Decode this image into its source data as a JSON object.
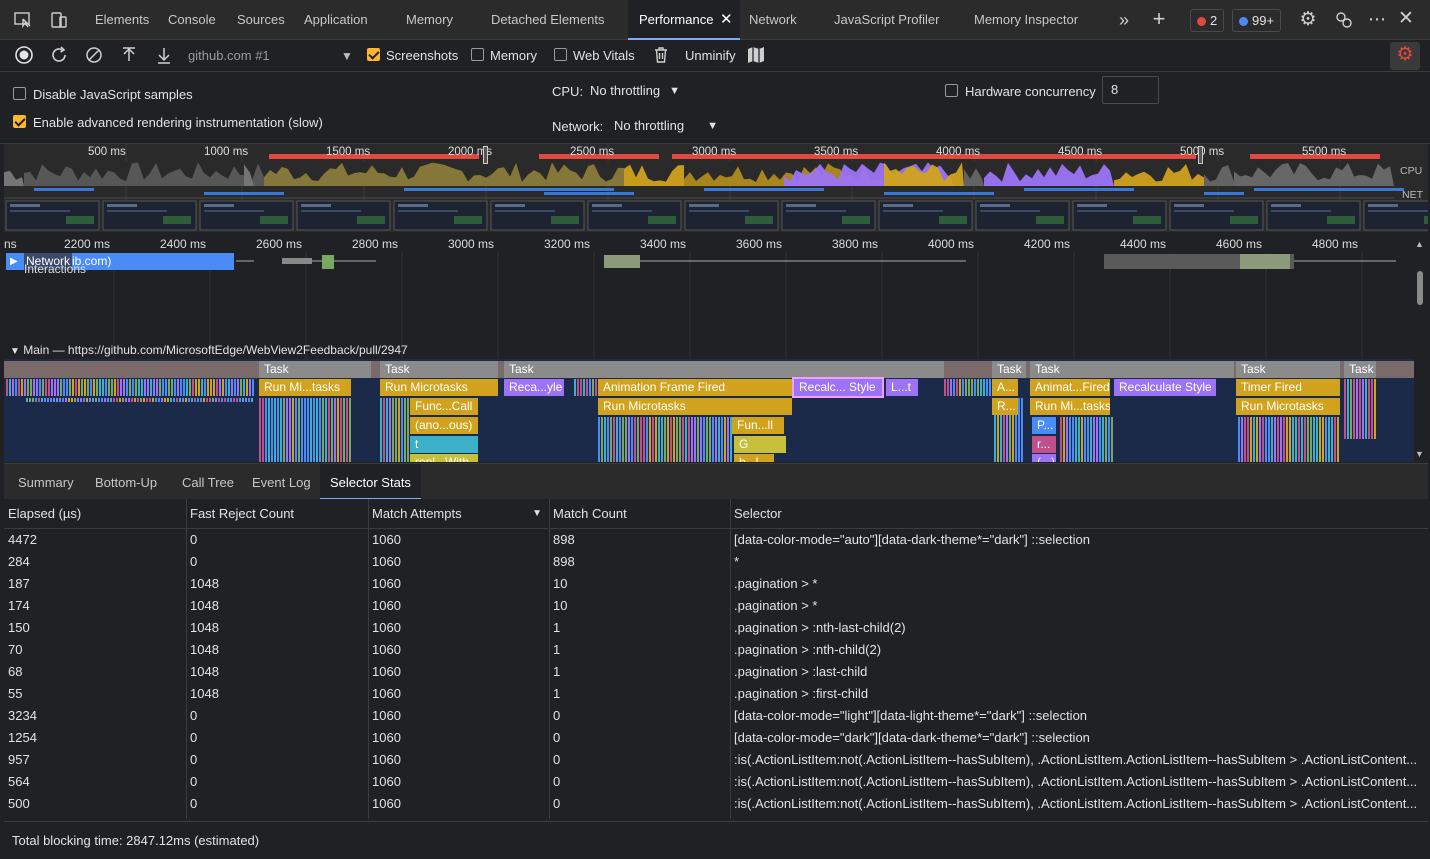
{
  "tabs": [
    {
      "label": "Elements"
    },
    {
      "label": "Console"
    },
    {
      "label": "Sources"
    },
    {
      "label": "Application"
    },
    {
      "label": "Memory"
    },
    {
      "label": "Detached Elements"
    },
    {
      "label": "Performance"
    },
    {
      "label": "Network"
    },
    {
      "label": "JavaScript Profiler"
    },
    {
      "label": "Memory Inspector"
    }
  ],
  "active_tab": "Performance",
  "badges": {
    "errors": "2",
    "messages": "99+"
  },
  "toolbar": {
    "target": "github.com #1",
    "screenshots_label": "Screenshots",
    "memory_label": "Memory",
    "web_vitals_label": "Web Vitals",
    "unminify_label": "Unminify"
  },
  "settings": {
    "disable_js_samples": "Disable JavaScript samples",
    "advanced_rendering": "Enable advanced rendering instrumentation (slow)",
    "cpu_label": "CPU:",
    "cpu_value": "No throttling",
    "network_label": "Network:",
    "network_value": "No throttling",
    "hw_concurrency_label": "Hardware concurrency",
    "hw_concurrency_value": "8"
  },
  "overview": {
    "ticks": [
      "500 ms",
      "1000 ms",
      "1500 ms",
      "2000 ms",
      "2500 ms",
      "3000 ms",
      "3500 ms",
      "4000 ms",
      "4500 ms",
      "5000 ms",
      "5500 ms"
    ],
    "cpu_label": "CPU",
    "net_label": "NET"
  },
  "flame": {
    "ticks": [
      "ns",
      "2200 ms",
      "2400 ms",
      "2600 ms",
      "2800 ms",
      "3000 ms",
      "3200 ms",
      "3400 ms",
      "3600 ms",
      "3800 ms",
      "4000 ms",
      "4200 ms",
      "4400 ms",
      "4600 ms",
      "4800 ms"
    ],
    "network_track": "Network",
    "network_track_suffix": "ib.com)",
    "interactions_label": "Interactions",
    "main_label": "Main — https://github.com/MicrosoftEdge/WebView2Feedback/pull/2947",
    "blocks": [
      {
        "t": "Task"
      },
      {
        "t": "Task"
      },
      {
        "t": "Task"
      },
      {
        "t": "Task"
      },
      {
        "t": "Task"
      },
      {
        "t": "Task"
      },
      {
        "t": "Task"
      },
      {
        "t": "Run Mi...tasks"
      },
      {
        "t": "Run Microtasks"
      },
      {
        "t": "Reca...yle"
      },
      {
        "t": "Animation Frame Fired"
      },
      {
        "t": "Recalc... Style"
      },
      {
        "t": "L...t"
      },
      {
        "t": "A..."
      },
      {
        "t": "Animat...Fired"
      },
      {
        "t": "Recalculate Style"
      },
      {
        "t": "Timer Fired"
      },
      {
        "t": "Func...Call"
      },
      {
        "t": "Run Microtasks"
      },
      {
        "t": "R..."
      },
      {
        "t": "Run Mi...tasks"
      },
      {
        "t": "Run Microtasks"
      },
      {
        "t": "(ano...ous)"
      },
      {
        "t": "Fun...ll"
      },
      {
        "t": "P..."
      },
      {
        "t": "t"
      },
      {
        "t": "G"
      },
      {
        "t": "r..."
      },
      {
        "t": "repl...With"
      },
      {
        "t": "b...l"
      },
      {
        "t": "(...)"
      }
    ]
  },
  "bottom_tabs": [
    "Summary",
    "Bottom-Up",
    "Call Tree",
    "Event Log",
    "Selector Stats"
  ],
  "active_bottom_tab": "Selector Stats",
  "table": {
    "headers": [
      "Elapsed (µs)",
      "Fast Reject Count",
      "Match Attempts",
      "Match Count",
      "Selector"
    ],
    "rows": [
      [
        "4472",
        "0",
        "1060",
        "898",
        "[data-color-mode=\"auto\"][data-dark-theme*=\"dark\"] ::selection"
      ],
      [
        "284",
        "0",
        "1060",
        "898",
        "*"
      ],
      [
        "187",
        "1048",
        "1060",
        "10",
        ".pagination > *"
      ],
      [
        "174",
        "1048",
        "1060",
        "10",
        ".pagination > *"
      ],
      [
        "150",
        "1048",
        "1060",
        "1",
        ".pagination > :nth-last-child(2)"
      ],
      [
        "70",
        "1048",
        "1060",
        "1",
        ".pagination > :nth-child(2)"
      ],
      [
        "68",
        "1048",
        "1060",
        "1",
        ".pagination > :last-child"
      ],
      [
        "55",
        "1048",
        "1060",
        "1",
        ".pagination > :first-child"
      ],
      [
        "3234",
        "0",
        "1060",
        "0",
        "[data-color-mode=\"light\"][data-light-theme*=\"dark\"] ::selection"
      ],
      [
        "1254",
        "0",
        "1060",
        "0",
        "[data-color-mode=\"dark\"][data-dark-theme*=\"dark\"] ::selection"
      ],
      [
        "957",
        "0",
        "1060",
        "0",
        ":is(.ActionListItem:not(.ActionListItem--hasSubItem), .ActionListItem.ActionListItem--hasSubItem > .ActionListContent..."
      ],
      [
        "564",
        "0",
        "1060",
        "0",
        ":is(.ActionListItem:not(.ActionListItem--hasSubItem), .ActionListItem.ActionListItem--hasSubItem > .ActionListContent..."
      ],
      [
        "500",
        "0",
        "1060",
        "0",
        ":is(.ActionListItem:not(.ActionListItem--hasSubItem), .ActionListItem.ActionListItem--hasSubItem > .ActionListContent..."
      ]
    ]
  },
  "footer": "Total blocking time: 2847.12ms (estimated)",
  "colors": {
    "accent": "#7cacf8",
    "task": "#8b8b8b",
    "scripting": "#d0a21d",
    "rendering": "#9c73f6",
    "long_task": "#e2483d",
    "checkbox": "#fbb72d"
  }
}
